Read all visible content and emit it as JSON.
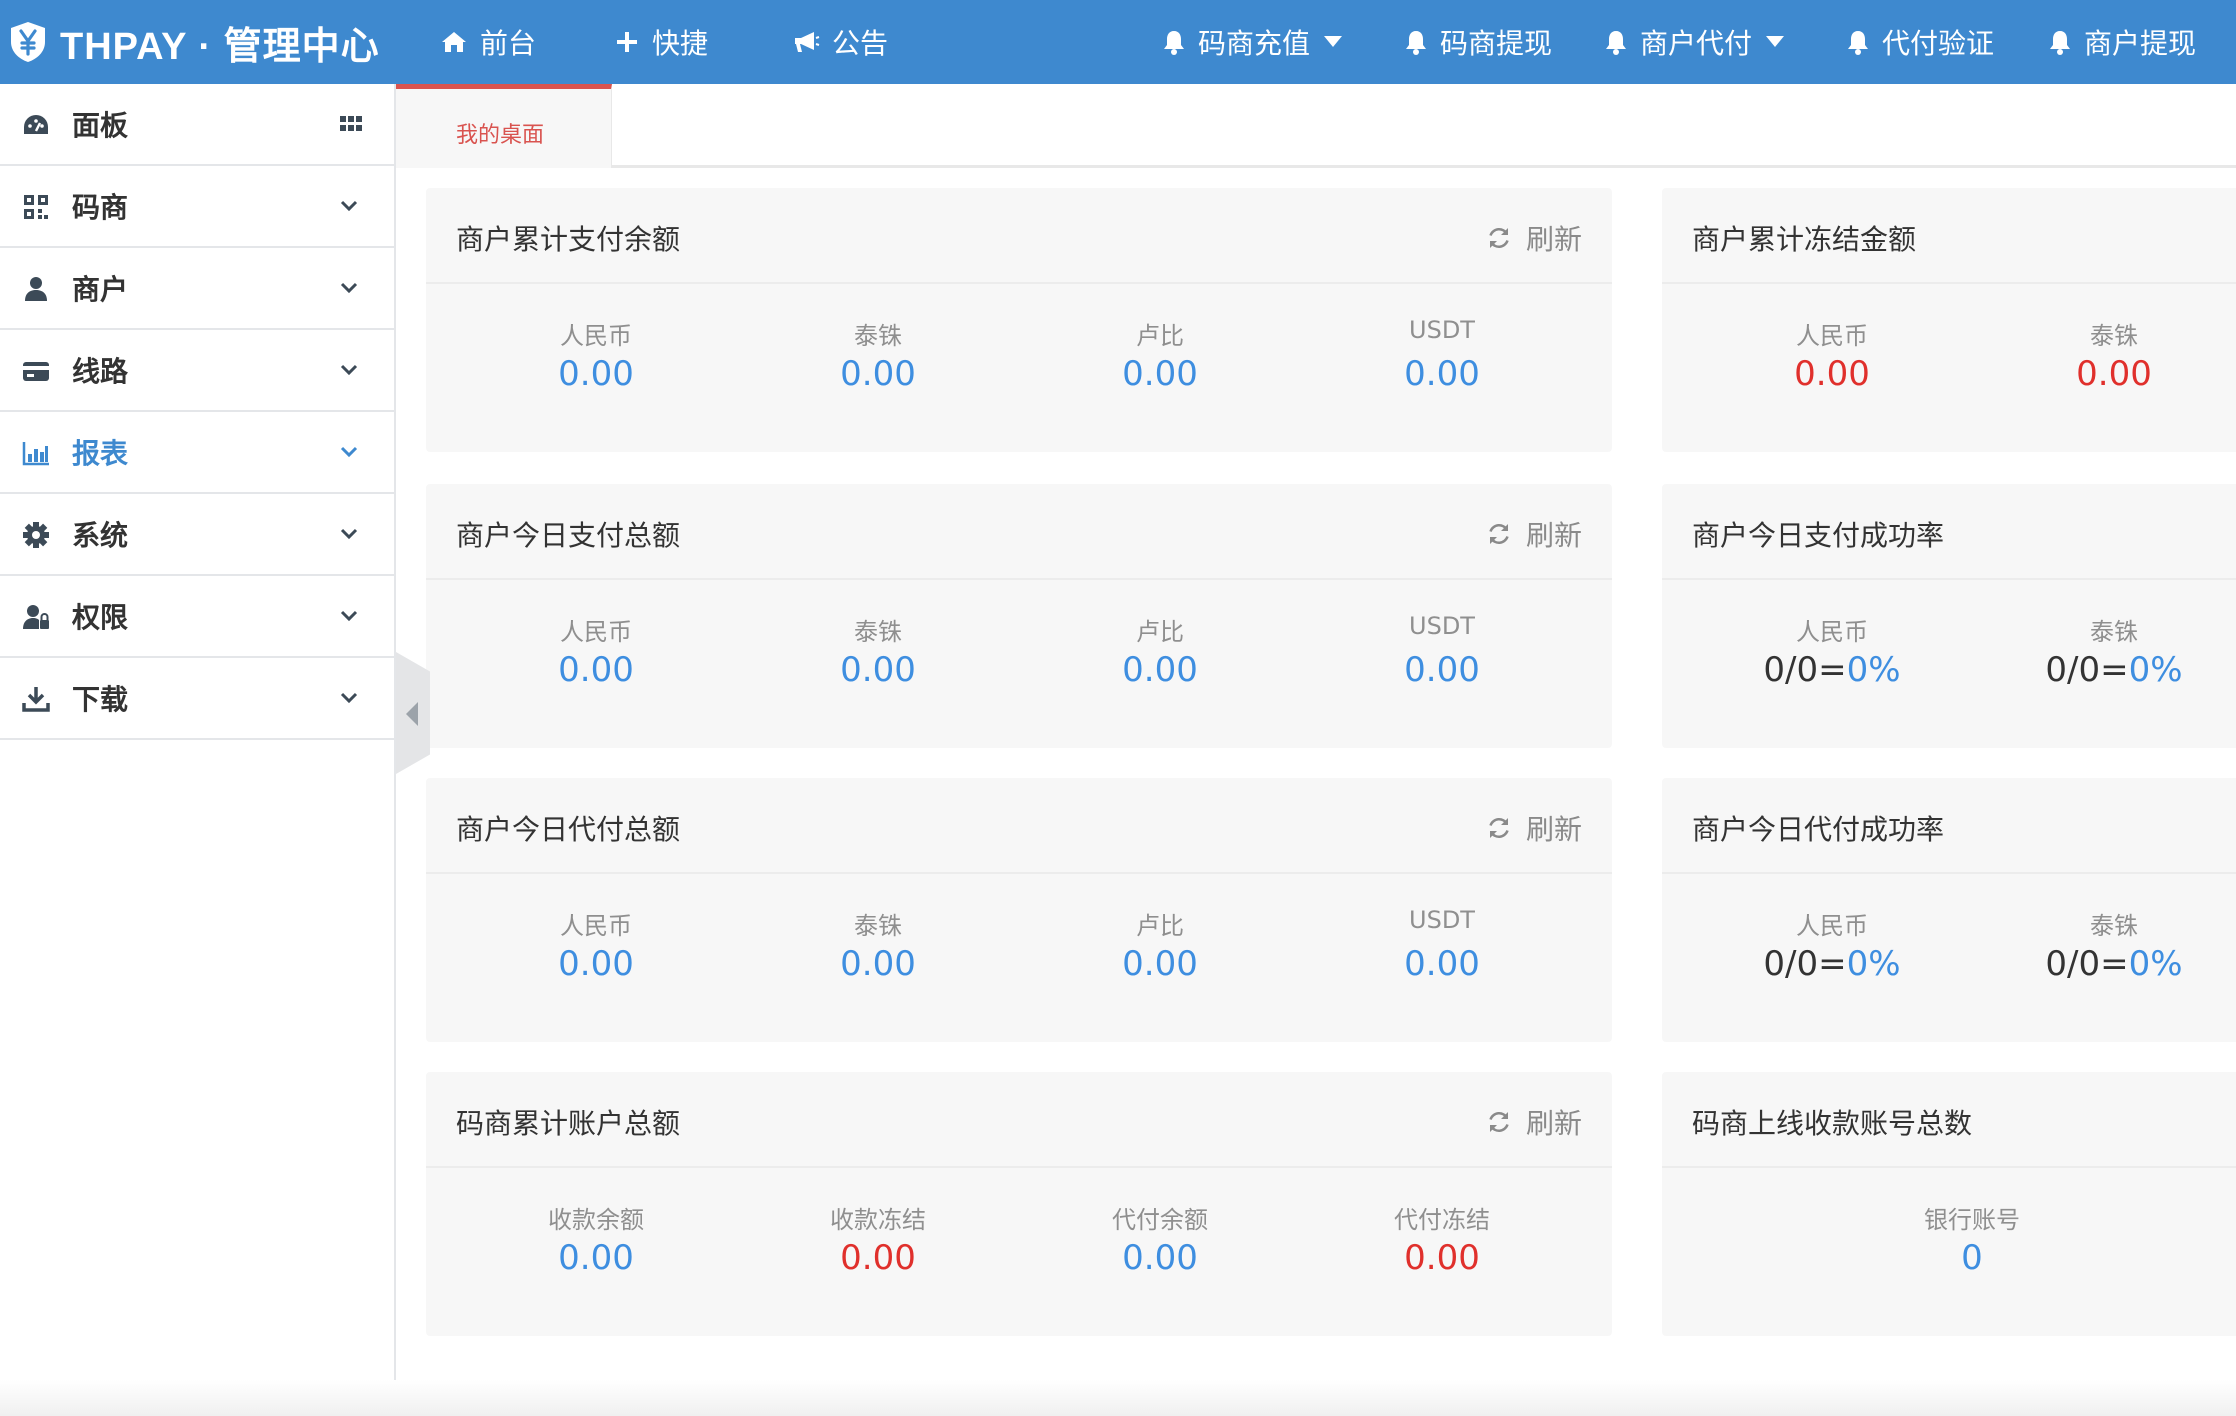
{
  "app": {
    "brand": "THPAY · 管理中心"
  },
  "topnav": {
    "left": [
      {
        "icon": "home-icon",
        "label": "前台"
      },
      {
        "icon": "plus-icon",
        "label": "快捷"
      },
      {
        "icon": "bullhorn-icon",
        "label": "公告"
      }
    ],
    "right": [
      {
        "icon": "bell-icon",
        "label": "码商充值",
        "dropdown": true
      },
      {
        "icon": "bell-icon",
        "label": "码商提现",
        "dropdown": false
      },
      {
        "icon": "bell-icon",
        "label": "商户代付",
        "dropdown": true
      },
      {
        "icon": "bell-icon",
        "label": "代付验证",
        "dropdown": false
      },
      {
        "icon": "bell-icon",
        "label": "商户提现",
        "dropdown": false
      }
    ]
  },
  "sidebar": {
    "items": [
      {
        "icon": "dashboard-icon",
        "label": "面板",
        "trailing": "grid-icon"
      },
      {
        "icon": "qrcode-icon",
        "label": "码商",
        "trailing": "chevron-down-icon"
      },
      {
        "icon": "user-icon",
        "label": "商户",
        "trailing": "chevron-down-icon"
      },
      {
        "icon": "credit-card-icon",
        "label": "线路",
        "trailing": "chevron-down-icon"
      },
      {
        "icon": "bar-chart-icon",
        "label": "报表",
        "trailing": "chevron-down-icon",
        "active": true
      },
      {
        "icon": "gear-icon",
        "label": "系统",
        "trailing": "chevron-down-icon"
      },
      {
        "icon": "user-lock-icon",
        "label": "权限",
        "trailing": "chevron-down-icon"
      },
      {
        "icon": "download-icon",
        "label": "下载",
        "trailing": "chevron-down-icon"
      }
    ]
  },
  "tabs": [
    {
      "label": "我的桌面",
      "active": true
    }
  ],
  "refresh_label": "刷新",
  "cards": {
    "balance": {
      "title": "商户累计支付余额",
      "cells": [
        {
          "label": "人民币",
          "value": "0.00"
        },
        {
          "label": "泰铢",
          "value": "0.00"
        },
        {
          "label": "卢比",
          "value": "0.00"
        },
        {
          "label": "USDT",
          "value": "0.00"
        }
      ]
    },
    "frozen": {
      "title": "商户累计冻结金额",
      "cells": [
        {
          "label": "人民币",
          "value": "0.00"
        },
        {
          "label": "泰铢",
          "value": "0.00"
        }
      ]
    },
    "pay_today": {
      "title": "商户今日支付总额",
      "cells": [
        {
          "label": "人民币",
          "value": "0.00"
        },
        {
          "label": "泰铢",
          "value": "0.00"
        },
        {
          "label": "卢比",
          "value": "0.00"
        },
        {
          "label": "USDT",
          "value": "0.00"
        }
      ]
    },
    "pay_rate": {
      "title": "商户今日支付成功率",
      "cells": [
        {
          "label": "人民币",
          "ratio": "0/0=",
          "pct": "0%"
        },
        {
          "label": "泰铢",
          "ratio": "0/0=",
          "pct": "0%"
        }
      ]
    },
    "payout_today": {
      "title": "商户今日代付总额",
      "cells": [
        {
          "label": "人民币",
          "value": "0.00"
        },
        {
          "label": "泰铢",
          "value": "0.00"
        },
        {
          "label": "卢比",
          "value": "0.00"
        },
        {
          "label": "USDT",
          "value": "0.00"
        }
      ]
    },
    "payout_rate": {
      "title": "商户今日代付成功率",
      "cells": [
        {
          "label": "人民币",
          "ratio": "0/0=",
          "pct": "0%"
        },
        {
          "label": "泰铢",
          "ratio": "0/0=",
          "pct": "0%"
        }
      ]
    },
    "code_accounts": {
      "title": "码商累计账户总额",
      "cells": [
        {
          "label": "收款余额",
          "value": "0.00"
        },
        {
          "label": "收款冻结",
          "value": "0.00"
        },
        {
          "label": "代付余额",
          "value": "0.00"
        },
        {
          "label": "代付冻结",
          "value": "0.00"
        }
      ]
    },
    "online_accounts": {
      "title": "码商上线收款账号总数",
      "cells": [
        {
          "label": "银行账号",
          "value": "0"
        }
      ]
    }
  },
  "colors": {
    "primary": "#3e89cf",
    "value_blue": "#3e8ee0",
    "value_red": "#e0302c",
    "tab_red": "#d9534f"
  }
}
